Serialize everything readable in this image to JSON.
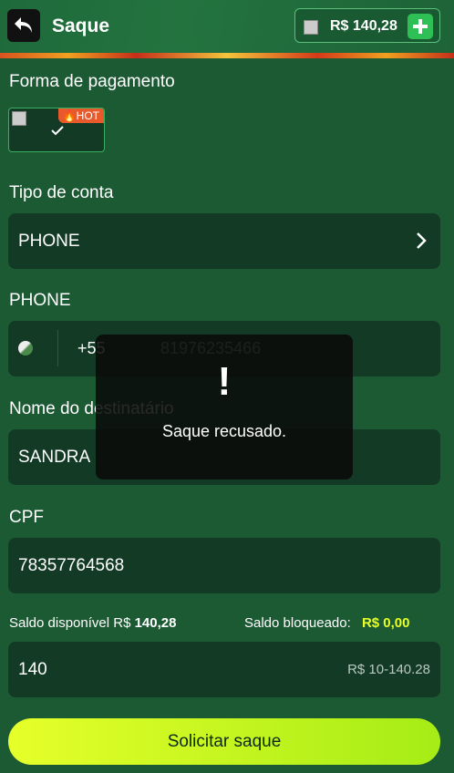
{
  "header": {
    "title": "Saque",
    "balance": "R$ 140,28"
  },
  "payment": {
    "label": "Forma de pagamento",
    "hot_badge": "HOT"
  },
  "account_type": {
    "label": "Tipo de conta",
    "value": "PHONE"
  },
  "phone": {
    "label": "PHONE",
    "country_code": "+55",
    "number": "81976235466"
  },
  "recipient": {
    "label": "Nome do destinatário",
    "value": "SANDRA"
  },
  "cpf": {
    "label": "CPF",
    "value": "78357764568"
  },
  "balances": {
    "available_label": "Saldo disponível R$",
    "available_value": "140,28",
    "blocked_label": "Saldo bloqueado:",
    "blocked_value": "R$ 0,00"
  },
  "amount": {
    "value": "140",
    "range": "R$ 10-140.28"
  },
  "submit_label": "Solicitar saque",
  "toast": {
    "icon": "!",
    "message": "Saque recusado."
  },
  "colors": {
    "background": "#1c5a34",
    "field": "#133a25",
    "accent": "#2fc055",
    "blocked_value": "#e6ff2a",
    "hot": "#e85a2c"
  }
}
